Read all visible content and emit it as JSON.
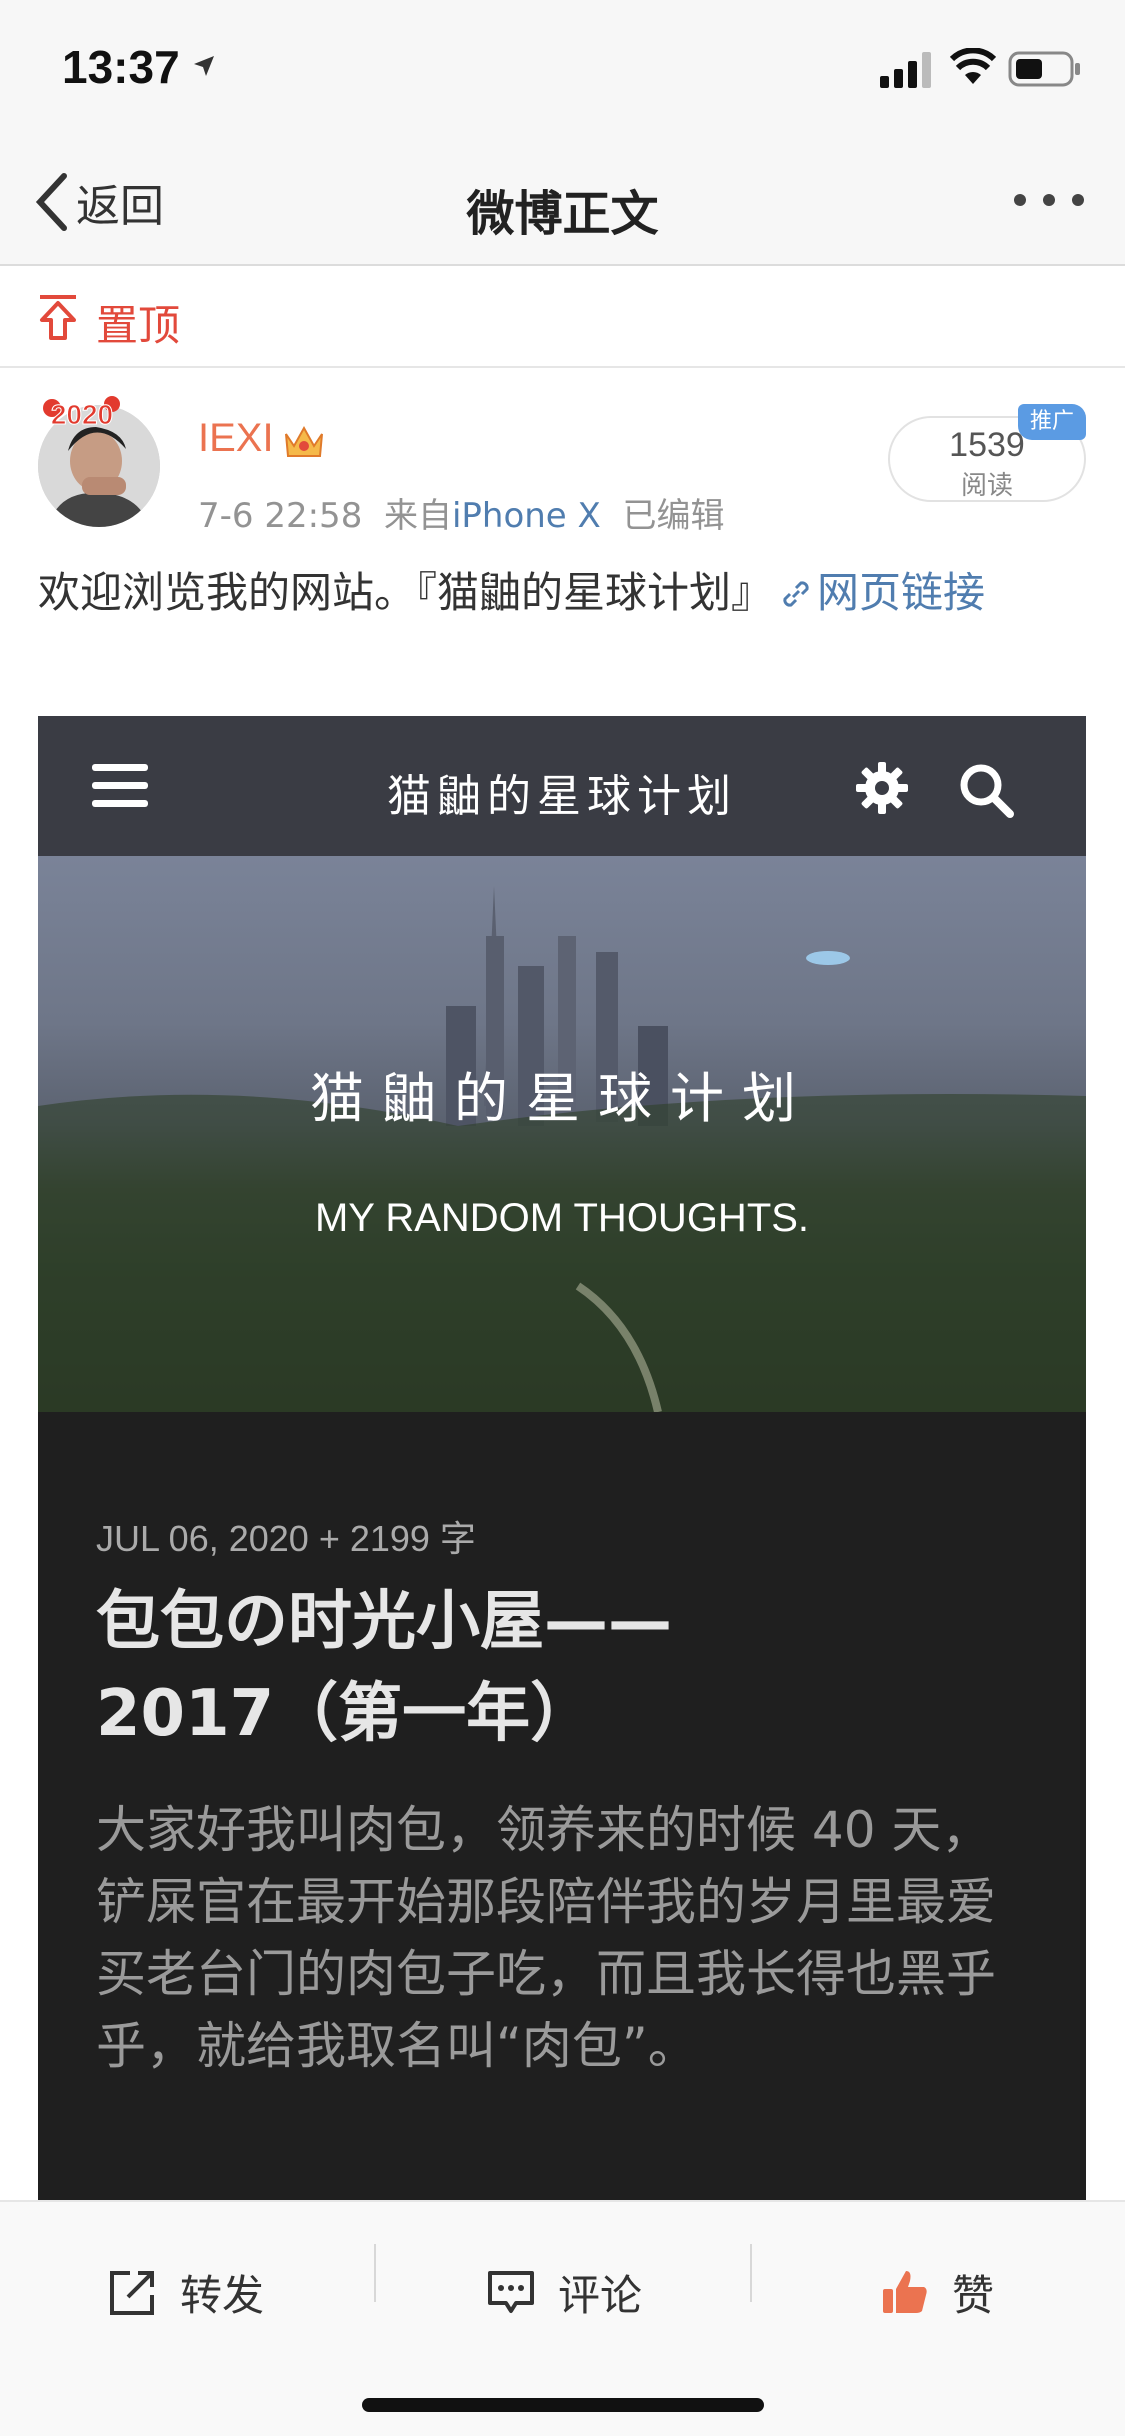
{
  "status_bar": {
    "time": "13:37"
  },
  "nav": {
    "back_label": "返回",
    "title": "微博正文"
  },
  "pinned": {
    "label": "置顶"
  },
  "author": {
    "name": "IEXI",
    "date": "7-6 22:58",
    "source_prefix": "来自",
    "source": "iPhone X",
    "edited": "已编辑",
    "avatar_badge": "2020"
  },
  "reads": {
    "count": "1539",
    "label": "阅读",
    "promo": "推广"
  },
  "post": {
    "text": "欢迎浏览我的网站。『猫鼬的星球计划』",
    "link_text": "网页链接"
  },
  "website": {
    "site_title": "猫鼬的星球计划",
    "hero_title": "猫鼬的星球计划",
    "hero_subtitle": "MY RANDOM THOUGHTS.",
    "article_meta": "JUL 06, 2020 + 2199 字",
    "article_title_line1": "包包の时光小屋——",
    "article_title_line2": "2017（第一年）",
    "article_body": "大家好我叫肉包，领养来的时候 40 天，铲屎官在最开始那段陪伴我的岁月里最爱买老台门的肉包子吃，而且我长得也黑乎乎，就给我取名叫“肉包”。"
  },
  "toolbar": {
    "repost": "转发",
    "comment": "评论",
    "like": "赞"
  },
  "colors": {
    "accent_orange": "#eb7350",
    "link_blue": "#507daf",
    "pin_red": "#e2493b",
    "promo_blue": "#5b9be3"
  },
  "icons": {
    "back": "chevron-left-icon",
    "more": "more-dots-icon",
    "pin": "pin-top-icon",
    "crown": "crown-icon",
    "link": "link-icon",
    "menu": "hamburger-icon",
    "gear": "gear-icon",
    "search": "search-icon",
    "repost": "repost-icon",
    "comment": "comment-icon",
    "like": "thumbs-up-icon"
  }
}
